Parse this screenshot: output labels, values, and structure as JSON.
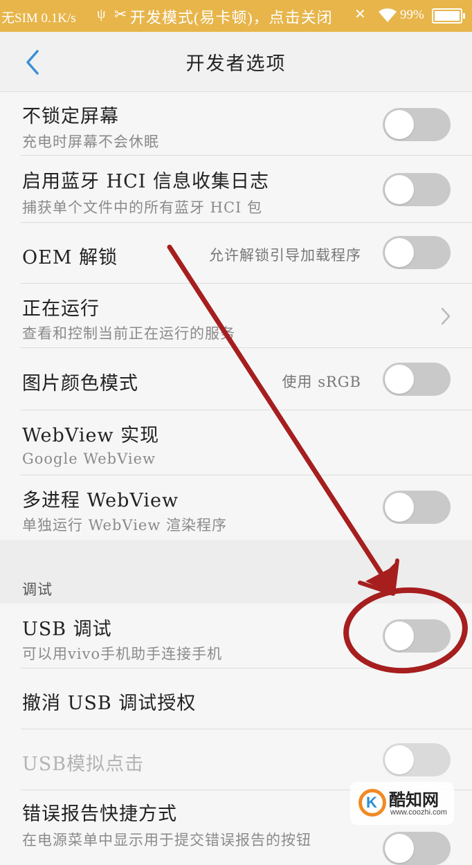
{
  "status_bar": {
    "carrier": "无SIM 0.1K/s",
    "notification": "开发模式(易卡顿)，点击关闭",
    "battery": "99%",
    "battery_level": 0.99
  },
  "header": {
    "title": "开发者选项"
  },
  "rows": [
    {
      "title": "不锁定屏幕",
      "subtitle": "充电时屏幕不会休眠",
      "toggle": false
    },
    {
      "title": "启用蓝牙 HCI 信息收集日志",
      "subtitle": "捕获单个文件中的所有蓝牙 HCI 包",
      "toggle": false
    },
    {
      "title": "OEM 解锁",
      "right_text": "允许解锁引导加载程序",
      "toggle": false
    },
    {
      "title": "正在运行",
      "subtitle": "查看和控制当前正在运行的服务"
    },
    {
      "title": "图片颜色模式",
      "right_text": "使用 sRGB",
      "toggle": false
    },
    {
      "title": "WebView 实现",
      "subtitle": "Google WebView"
    },
    {
      "title": "多进程 WebView",
      "subtitle": "单独运行 WebView 渲染程序",
      "toggle": false
    }
  ],
  "debug_section": {
    "label": "调试",
    "rows": [
      {
        "title": "USB 调试",
        "subtitle": "可以用vivo手机助手连接手机",
        "toggle": false
      },
      {
        "title": "撤消 USB 调试授权"
      },
      {
        "title": "USB模拟点击",
        "toggle": false,
        "disabled": true
      },
      {
        "title": "错误报告快捷方式",
        "subtitle": "在电源菜单中显示用于提交错误报告的按钮",
        "toggle": false
      }
    ]
  },
  "annotation": {
    "color": "#a61e1e"
  },
  "watermark": {
    "name": "酷知网",
    "url": "www.coozhi.com"
  },
  "colors": {
    "status_bar": "#e7b54a",
    "accent_blue": "#3c8fd8",
    "toggle_off": "#c9c9c9"
  }
}
